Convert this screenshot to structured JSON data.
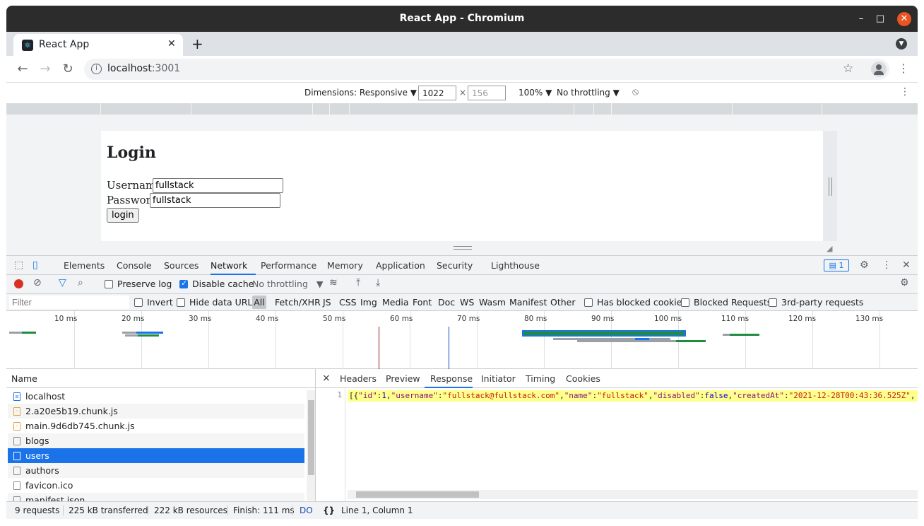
{
  "window": {
    "title": "React App - Chromium"
  },
  "tab": {
    "label": "React App",
    "close": "✕",
    "new_tab": "+"
  },
  "toolbar": {
    "url_host": "localhost",
    "url_port": ":3001"
  },
  "device_toolbar": {
    "dimensions_label": "Dimensions: Responsive ▼",
    "width": "1022",
    "height_placeholder": "156",
    "times": "×",
    "zoom": "100% ▼",
    "throttling": "No throttling ▼"
  },
  "page": {
    "heading": "Login",
    "username_label": "Username",
    "username_value": "fullstack",
    "password_label": "Password",
    "password_value": "fullstack",
    "login_button": "login"
  },
  "devtools": {
    "tabs": [
      "Elements",
      "Console",
      "Sources",
      "Network",
      "Performance",
      "Memory",
      "Application",
      "Security",
      "Lighthouse"
    ],
    "active_tab": "Network",
    "issues_count": "1"
  },
  "network_toolbar": {
    "preserve_log": "Preserve log",
    "disable_cache": "Disable cache",
    "throttling": "No throttling"
  },
  "filter_bar": {
    "placeholder": "Filter",
    "invert": "Invert",
    "hide_data_urls": "Hide data URLs",
    "types": [
      "All",
      "Fetch/XHR",
      "JS",
      "CSS",
      "Img",
      "Media",
      "Font",
      "Doc",
      "WS",
      "Wasm",
      "Manifest",
      "Other"
    ],
    "has_blocked_cookies": "Has blocked cookies",
    "blocked_requests": "Blocked Requests",
    "third_party": "3rd-party requests"
  },
  "timeline": {
    "ticks": [
      "10 ms",
      "20 ms",
      "30 ms",
      "40 ms",
      "50 ms",
      "60 ms",
      "70 ms",
      "80 ms",
      "90 ms",
      "100 ms",
      "110 ms",
      "120 ms",
      "130 ms"
    ]
  },
  "requests": {
    "header": "Name",
    "rows": [
      "localhost",
      "2.a20e5b19.chunk.js",
      "main.9d6db745.chunk.js",
      "blogs",
      "users",
      "authors",
      "favicon.ico",
      "manifest.json"
    ],
    "selected": "users"
  },
  "response_panel": {
    "tabs": [
      "Headers",
      "Preview",
      "Response",
      "Initiator",
      "Timing",
      "Cookies"
    ],
    "active_tab": "Response",
    "close": "×",
    "line_number": "1",
    "json": {
      "p1": "[{",
      "k1": "\"id\"",
      "v1": "1",
      "k2": "\"username\"",
      "v2": "\"fullstack@fullstack.com\"",
      "k3": "\"name\"",
      "v3": "\"fullstack\"",
      "k4": "\"disabled\"",
      "v4": "false",
      "k5": "\"createdAt\"",
      "v5": "\"2021-12-28T00:43:36.525Z\""
    }
  },
  "status": {
    "requests": "9 requests",
    "transferred": "225 kB transferred",
    "resources": "222 kB resources",
    "finish": "Finish: 111 ms",
    "dom": "DO",
    "cursor": "Line 1, Column 1",
    "braces": "{}"
  }
}
